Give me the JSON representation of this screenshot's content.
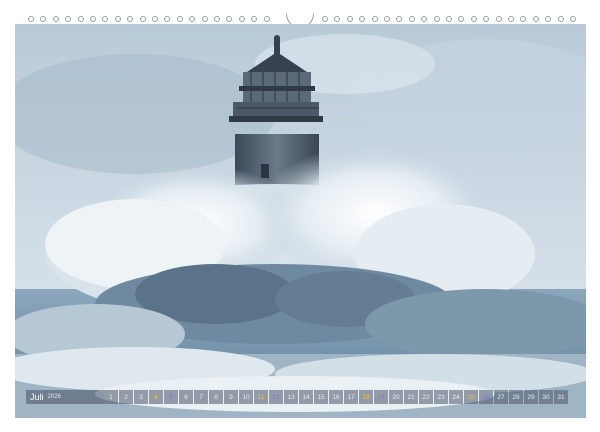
{
  "calendar": {
    "month": "Juli",
    "year": "2026",
    "days": [
      {
        "n": "1",
        "type": "wd"
      },
      {
        "n": "2",
        "type": "wd"
      },
      {
        "n": "3",
        "type": "wd"
      },
      {
        "n": "4",
        "type": "sat"
      },
      {
        "n": "5",
        "type": "sun"
      },
      {
        "n": "6",
        "type": "wd"
      },
      {
        "n": "7",
        "type": "wd"
      },
      {
        "n": "8",
        "type": "wd"
      },
      {
        "n": "9",
        "type": "wd"
      },
      {
        "n": "10",
        "type": "wd"
      },
      {
        "n": "11",
        "type": "sat"
      },
      {
        "n": "12",
        "type": "sun"
      },
      {
        "n": "13",
        "type": "wd"
      },
      {
        "n": "14",
        "type": "wd"
      },
      {
        "n": "15",
        "type": "wd"
      },
      {
        "n": "16",
        "type": "wd"
      },
      {
        "n": "17",
        "type": "wd"
      },
      {
        "n": "18",
        "type": "sat"
      },
      {
        "n": "19",
        "type": "sun"
      },
      {
        "n": "20",
        "type": "wd"
      },
      {
        "n": "21",
        "type": "wd"
      },
      {
        "n": "22",
        "type": "wd"
      },
      {
        "n": "23",
        "type": "wd"
      },
      {
        "n": "24",
        "type": "wd"
      },
      {
        "n": "25",
        "type": "sat"
      },
      {
        "n": "26",
        "type": "sun"
      },
      {
        "n": "27",
        "type": "wd"
      },
      {
        "n": "28",
        "type": "wd"
      },
      {
        "n": "29",
        "type": "wd"
      },
      {
        "n": "30",
        "type": "wd"
      },
      {
        "n": "31",
        "type": "wd"
      }
    ]
  },
  "colors": {
    "saturday": "#f2c14a",
    "sunday": "#7b78d8",
    "weekday": "#e8ecf2"
  },
  "photo": {
    "subject": "lighthouse-in-storm"
  }
}
